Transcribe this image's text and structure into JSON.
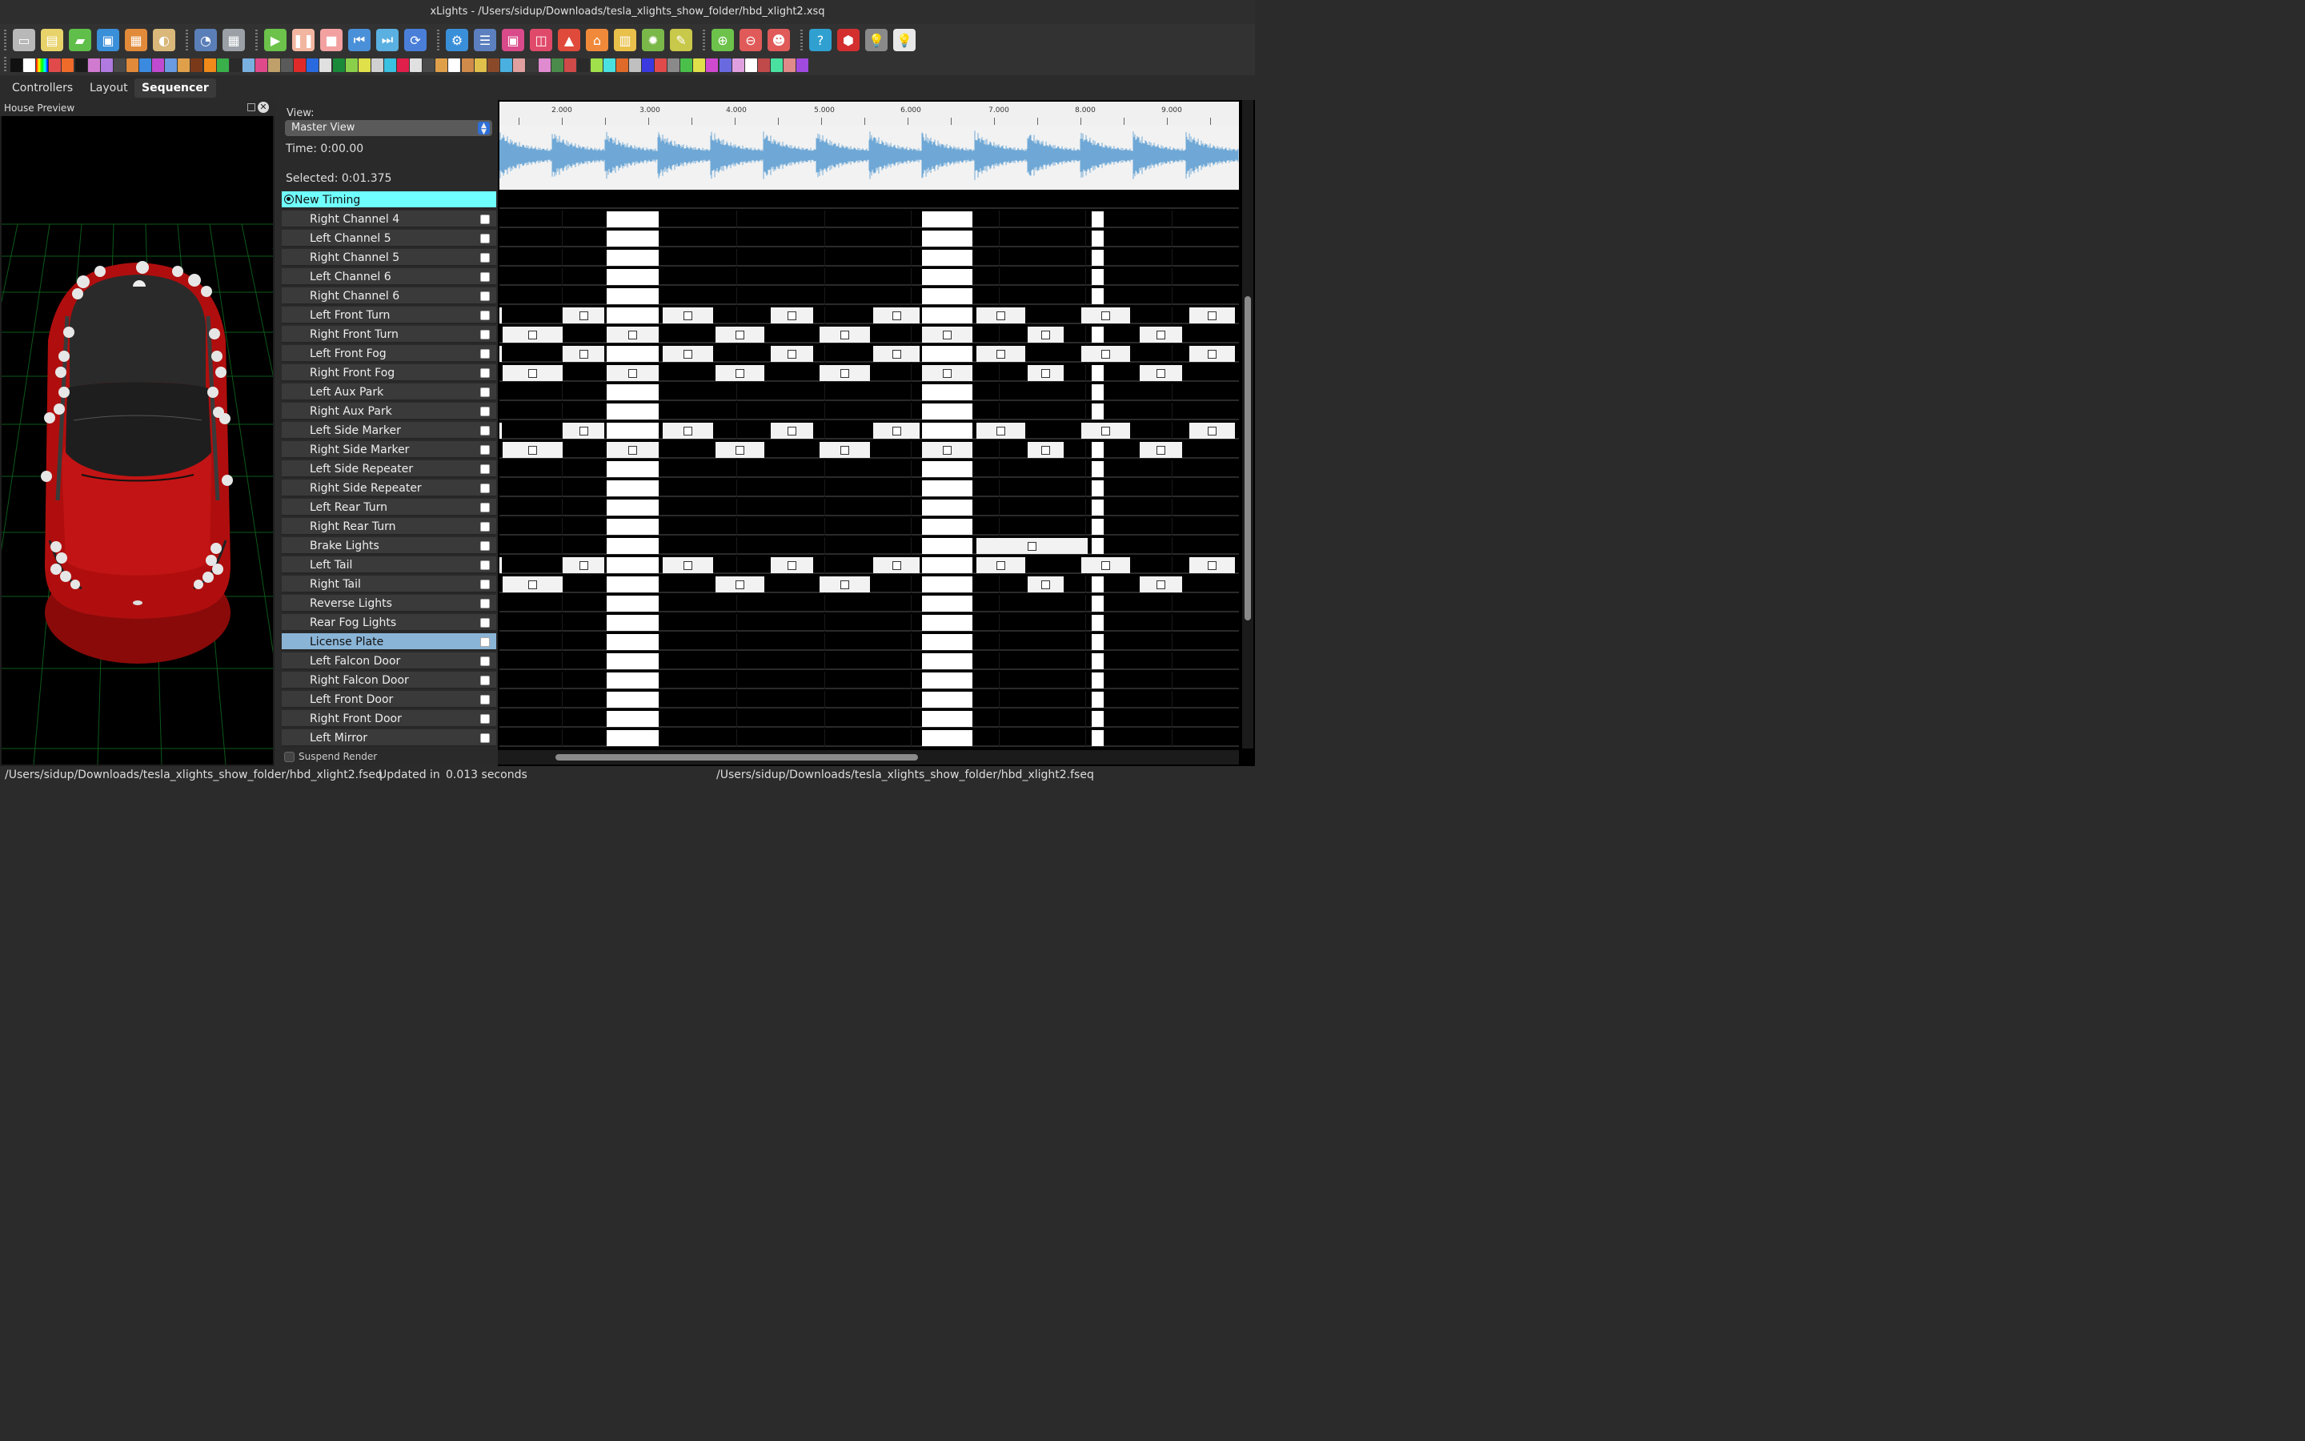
{
  "window": {
    "title": "xLights - /Users/sidup/Downloads/tesla_xlights_show_folder/hbd_xlight2.xsq"
  },
  "toolbar": {
    "groups": [
      {
        "icons": [
          {
            "name": "open-folder-icon",
            "color": "#b8b8b8",
            "glyph": "▭"
          },
          {
            "name": "new-sequence-icon",
            "color": "#e8d36a",
            "glyph": "▤"
          },
          {
            "name": "open-sequence-icon",
            "color": "#5fbf4a",
            "glyph": "▰"
          },
          {
            "name": "save-icon",
            "color": "#3a8fd9",
            "glyph": "▣"
          },
          {
            "name": "save-as-icon",
            "color": "#e08a3a",
            "glyph": "▦"
          },
          {
            "name": "palette-icon",
            "color": "#d9b87a",
            "glyph": "◐"
          }
        ]
      },
      {
        "icons": [
          {
            "name": "timer-icon",
            "color": "#5a7fb8",
            "glyph": "◔"
          },
          {
            "name": "calculator-icon",
            "color": "#9aa0a6",
            "glyph": "▦"
          }
        ]
      },
      {
        "icons": [
          {
            "name": "play-icon",
            "color": "#6cc24a",
            "glyph": "▶"
          },
          {
            "name": "pause-icon",
            "color": "#f2b6a0",
            "glyph": "❚❚"
          },
          {
            "name": "stop-icon",
            "color": "#f2a0a0",
            "glyph": "■"
          },
          {
            "name": "rewind-icon",
            "color": "#4a90d9",
            "glyph": "⏮"
          },
          {
            "name": "fast-forward-icon",
            "color": "#5ab0e0",
            "glyph": "⏭"
          },
          {
            "name": "replay-icon",
            "color": "#4a7fd9",
            "glyph": "⟳"
          }
        ]
      },
      {
        "icons": [
          {
            "name": "settings-gear-icon",
            "color": "#3a8fd9",
            "glyph": "⚙"
          },
          {
            "name": "sliders-icon",
            "color": "#5b7fbf",
            "glyph": "☰"
          },
          {
            "name": "models-icon",
            "color": "#d94a8a",
            "glyph": "▣"
          },
          {
            "name": "layers-icon",
            "color": "#e04a6a",
            "glyph": "◫"
          },
          {
            "name": "cone-icon",
            "color": "#e04a3a",
            "glyph": "▲"
          },
          {
            "name": "house-icon",
            "color": "#f08a3a",
            "glyph": "⌂"
          },
          {
            "name": "files-icon",
            "color": "#e8c04a",
            "glyph": "▥"
          },
          {
            "name": "burst-icon",
            "color": "#7ab84a",
            "glyph": "✹"
          },
          {
            "name": "wand-icon",
            "color": "#c8c84a",
            "glyph": "✎"
          }
        ]
      },
      {
        "icons": [
          {
            "name": "zoom-in-icon",
            "color": "#6cc24a",
            "glyph": "⊕"
          },
          {
            "name": "zoom-out-icon",
            "color": "#e05a5a",
            "glyph": "⊖"
          },
          {
            "name": "person-icon",
            "color": "#e05a5a",
            "glyph": "☻"
          }
        ]
      },
      {
        "icons": [
          {
            "name": "help-icon",
            "color": "#2fa0d0",
            "glyph": "?"
          },
          {
            "name": "stop-output-icon",
            "color": "#d32f2f",
            "glyph": "⬢"
          },
          {
            "name": "bulb-off-icon",
            "color": "#8a8a8a",
            "glyph": "💡"
          },
          {
            "name": "bulb-on-icon",
            "color": "#e8e8e8",
            "glyph": "💡"
          }
        ]
      }
    ]
  },
  "effects_bar": {
    "icon_colors": [
      "#111111",
      "#ffffff",
      "linear-gradient(90deg,#f00,#ff0,#0f0,#0ff,#00f)",
      "#e04a4a",
      "#f06a2a",
      "#1a1a1a",
      "#d07ad0",
      "#b07ae0",
      "#4a4a4a",
      "#e08a3a",
      "#3a8ae0",
      "#c04ad0",
      "#6a9ae0",
      "#e0a04a",
      "#7a3a1a",
      "#f08a1a",
      "#3ab04a",
      "#2a2a2a",
      "#7ab0e0",
      "#e04a8a",
      "#c0a06a",
      "#5a5a5a",
      "#e02a2a",
      "#2a6ae0",
      "#e0e0e0",
      "#1a8a3a",
      "#8ad04a",
      "#e0e04a",
      "#d0d0d0",
      "#3ac0e0",
      "#e0204a",
      "#e0e0e0",
      "#4a4a4a",
      "#e0a04a",
      "#ffffff",
      "#d08a4a",
      "#e0c04a",
      "#8a4a2a",
      "#4ab0e0",
      "#e0a0a0",
      "#3a3a3a",
      "#e08ad0",
      "#4a8a4a",
      "#d04a4a",
      "#2a2a2a",
      "#a0e04a",
      "#4ae0e0",
      "#e06a2a",
      "#c0c0c0",
      "#3a3ae0",
      "#e04a4a",
      "#8a8a8a",
      "#4ac04a",
      "#e0e04a",
      "#d04ad0",
      "#6a6ae0",
      "#e0a0e0",
      "#ffffff",
      "#c04a4a",
      "#4ae0a0",
      "#e08a8a",
      "#a04ae0"
    ]
  },
  "tabs": [
    {
      "label": "Controllers"
    },
    {
      "label": "Layout"
    },
    {
      "label": "Sequencer"
    }
  ],
  "active_tab": "Sequencer",
  "house_preview": {
    "title": "House Preview"
  },
  "sequencer": {
    "view_label": "View:",
    "view_value": "Master View",
    "time": "Time: 0:00.00",
    "selected": "Selected: 0:01.375",
    "timing_track": "New Timing",
    "suspend_render": "Suspend Render",
    "ruler_ticks": [
      "2.000",
      "3.000",
      "4.000",
      "5.000",
      "6.000",
      "7.000",
      "8.000",
      "9.000"
    ],
    "rows": [
      {
        "name": "Right Channel 4",
        "pattern": "solid"
      },
      {
        "name": "Left Channel 5",
        "pattern": "solid"
      },
      {
        "name": "Right Channel 5",
        "pattern": "solid"
      },
      {
        "name": "Left Channel 6",
        "pattern": "solid"
      },
      {
        "name": "Right Channel 6",
        "pattern": "solid"
      },
      {
        "name": "Left Front Turn",
        "pattern": "blinkA"
      },
      {
        "name": "Right Front Turn",
        "pattern": "blinkB"
      },
      {
        "name": "Left Front Fog",
        "pattern": "blinkA"
      },
      {
        "name": "Right Front Fog",
        "pattern": "blinkB"
      },
      {
        "name": "Left Aux Park",
        "pattern": "solid"
      },
      {
        "name": "Right Aux Park",
        "pattern": "solid"
      },
      {
        "name": "Left Side Marker",
        "pattern": "blinkA"
      },
      {
        "name": "Right Side Marker",
        "pattern": "blinkB"
      },
      {
        "name": "Left Side Repeater",
        "pattern": "solid"
      },
      {
        "name": "Right Side Repeater",
        "pattern": "solid"
      },
      {
        "name": "Left Rear Turn",
        "pattern": "solid"
      },
      {
        "name": "Right Rear Turn",
        "pattern": "solid"
      },
      {
        "name": "Brake Lights",
        "pattern": "brake"
      },
      {
        "name": "Left Tail",
        "pattern": "blinkA"
      },
      {
        "name": "Right Tail",
        "pattern": "tailR"
      },
      {
        "name": "Reverse Lights",
        "pattern": "solid"
      },
      {
        "name": "Rear Fog Lights",
        "pattern": "solid"
      },
      {
        "name": "License Plate",
        "pattern": "solid",
        "selected": true
      },
      {
        "name": "Left Falcon Door",
        "pattern": "solid"
      },
      {
        "name": "Right Falcon Door",
        "pattern": "solid"
      },
      {
        "name": "Left Front Door",
        "pattern": "solid"
      },
      {
        "name": "Right Front Door",
        "pattern": "solid"
      },
      {
        "name": "Left Mirror",
        "pattern": "solid"
      }
    ]
  },
  "status": {
    "left_path": "/Users/sidup/Downloads/tesla_xlights_show_folder/hbd_xlight2.fseq",
    "updated": "Updated in",
    "seconds": "0.013 seconds",
    "right_path": "/Users/sidup/Downloads/tesla_xlights_show_folder/hbd_xlight2.fseq"
  }
}
